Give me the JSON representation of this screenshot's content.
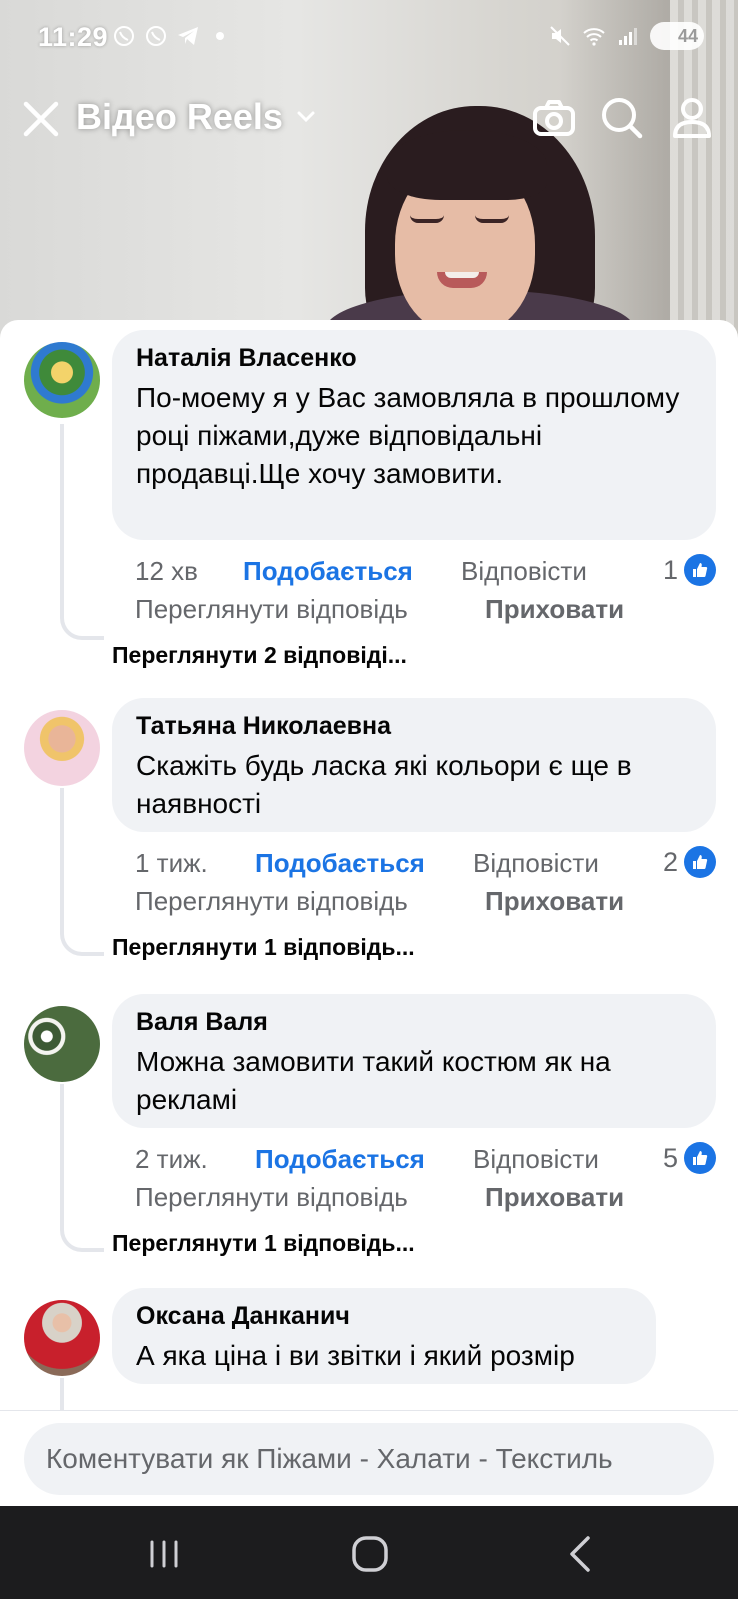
{
  "status_bar": {
    "time": "11:29",
    "battery": "44"
  },
  "header": {
    "title": "Відео Reels"
  },
  "comments": [
    {
      "author": "Наталія Власенко",
      "text": "По-моему я у Вас замовляла в прошлому році піжами,дуже відповідальні продавці.Ще хочу замовити.",
      "time": "12 хв",
      "like_label": "Подобається",
      "reply_label": "Відповісти",
      "reaction_count": "1",
      "view_reply_label": "Переглянути відповідь",
      "hide_label": "Приховати",
      "view_replies": "Переглянути 2 відповіді..."
    },
    {
      "author": "Татьяна Николаевна",
      "text": "Скажіть будь ласка які кольори є ще в наявності",
      "time": "1 тиж.",
      "like_label": "Подобається",
      "reply_label": "Відповісти",
      "reaction_count": "2",
      "view_reply_label": "Переглянути відповідь",
      "hide_label": "Приховати",
      "view_replies": "Переглянути 1 відповідь..."
    },
    {
      "author": "Валя Валя",
      "text": "Можна замовити такий костюм як на рекламі",
      "time": "2 тиж.",
      "like_label": "Подобається",
      "reply_label": "Відповісти",
      "reaction_count": "5",
      "view_reply_label": "Переглянути відповідь",
      "hide_label": "Приховати",
      "view_replies": "Переглянути 1 відповідь..."
    },
    {
      "author": "Оксана Данканич",
      "text": "А яка ціна і ви звітки і який розмір"
    }
  ],
  "comment_input": {
    "placeholder": "Коментувати як Піжами - Халати - Текстиль"
  },
  "colors": {
    "accent": "#1b74e4",
    "bubble": "#f0f2f5",
    "muted": "#65676b"
  }
}
